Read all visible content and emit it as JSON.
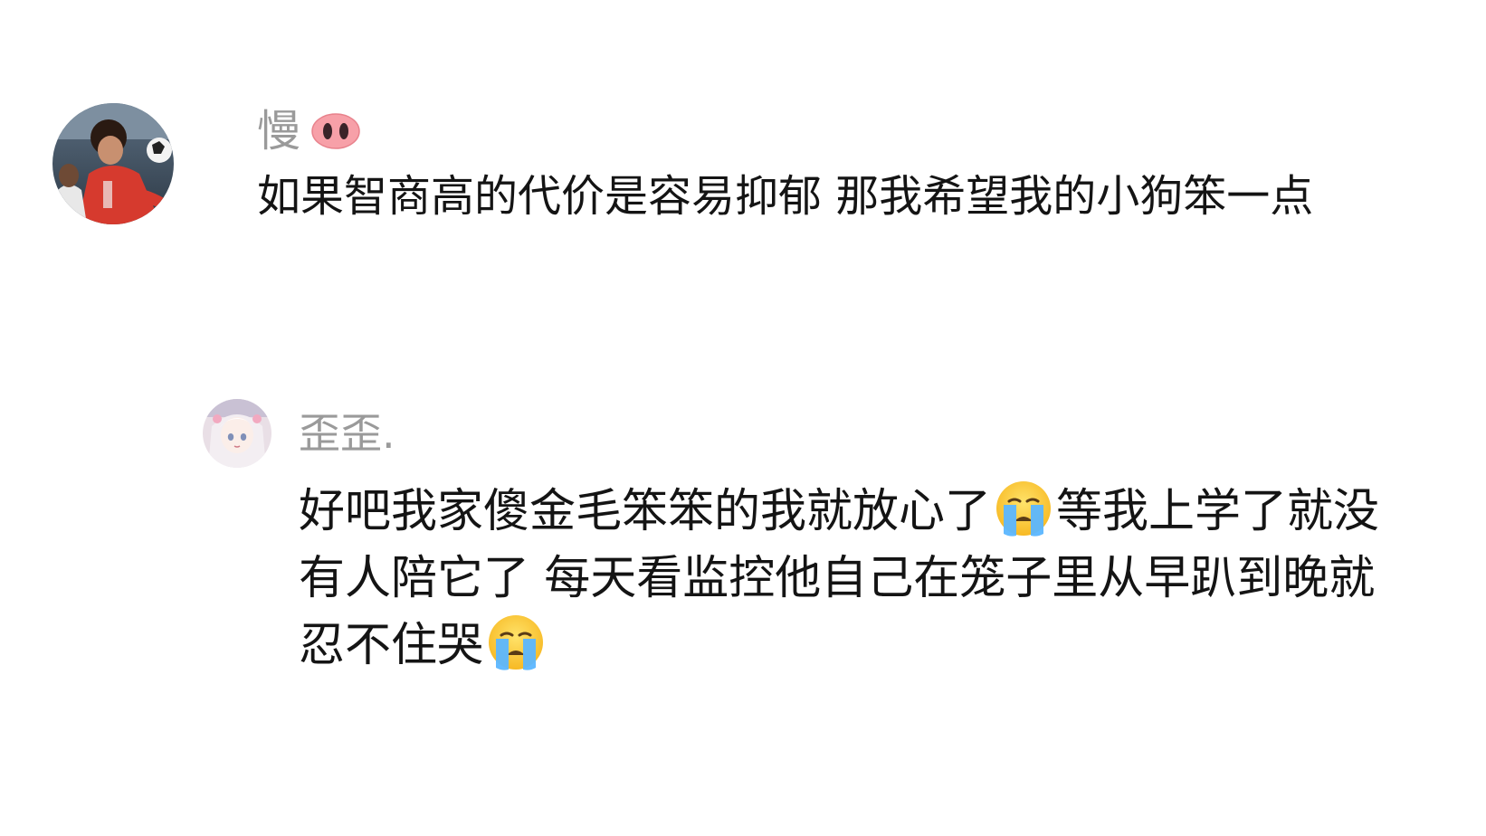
{
  "comments": [
    {
      "username": "慢",
      "username_badge_icon": "pig-nose-icon",
      "text": "如果智商高的代价是容易抑郁 那我希望我的小狗笨一点",
      "avatar_icon": "soccer-player-avatar"
    },
    {
      "username": "歪歪.",
      "avatar_icon": "anime-girl-avatar",
      "text_parts": [
        "好吧我家傻金毛笨笨的我就放心了",
        "等我上学了就没有人陪它了 每天看监控他自己在笼子里从早趴到晚就忍不住哭"
      ],
      "emoji_icon": "loudly-crying-face-icon"
    }
  ],
  "colors": {
    "username": "#9a9a9a",
    "text": "#141414",
    "background": "#ffffff",
    "pig_badge": "#f7a0a8"
  }
}
